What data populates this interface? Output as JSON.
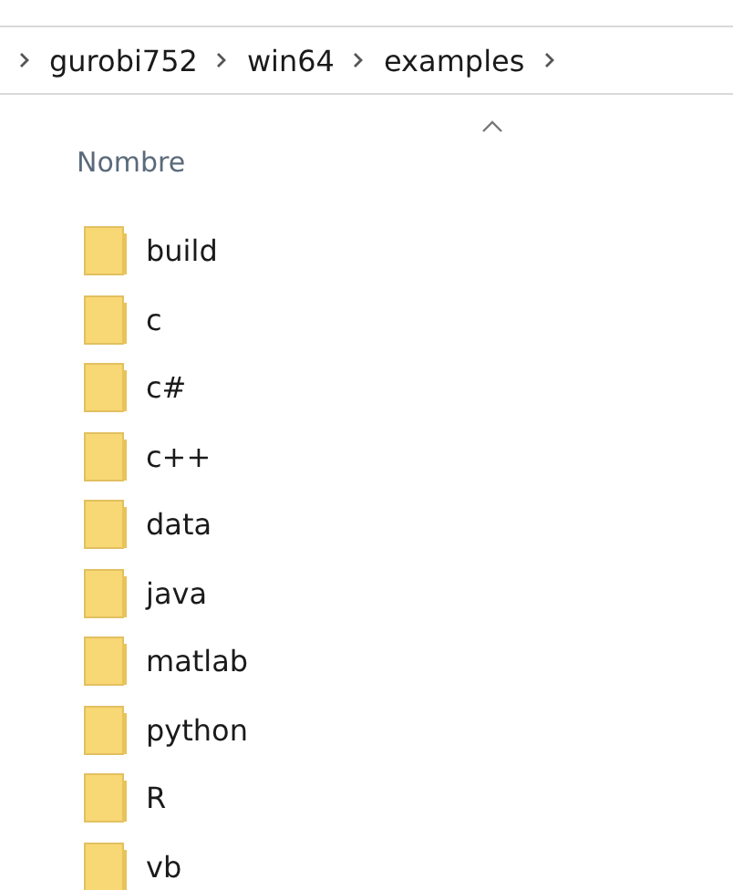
{
  "breadcrumb": [
    "gurobi752",
    "win64",
    "examples"
  ],
  "column_header": {
    "label": "Nombre",
    "sort_ascending": true
  },
  "folders": [
    "build",
    "c",
    "c#",
    "c++",
    "data",
    "java",
    "matlab",
    "python",
    "R",
    "vb"
  ]
}
